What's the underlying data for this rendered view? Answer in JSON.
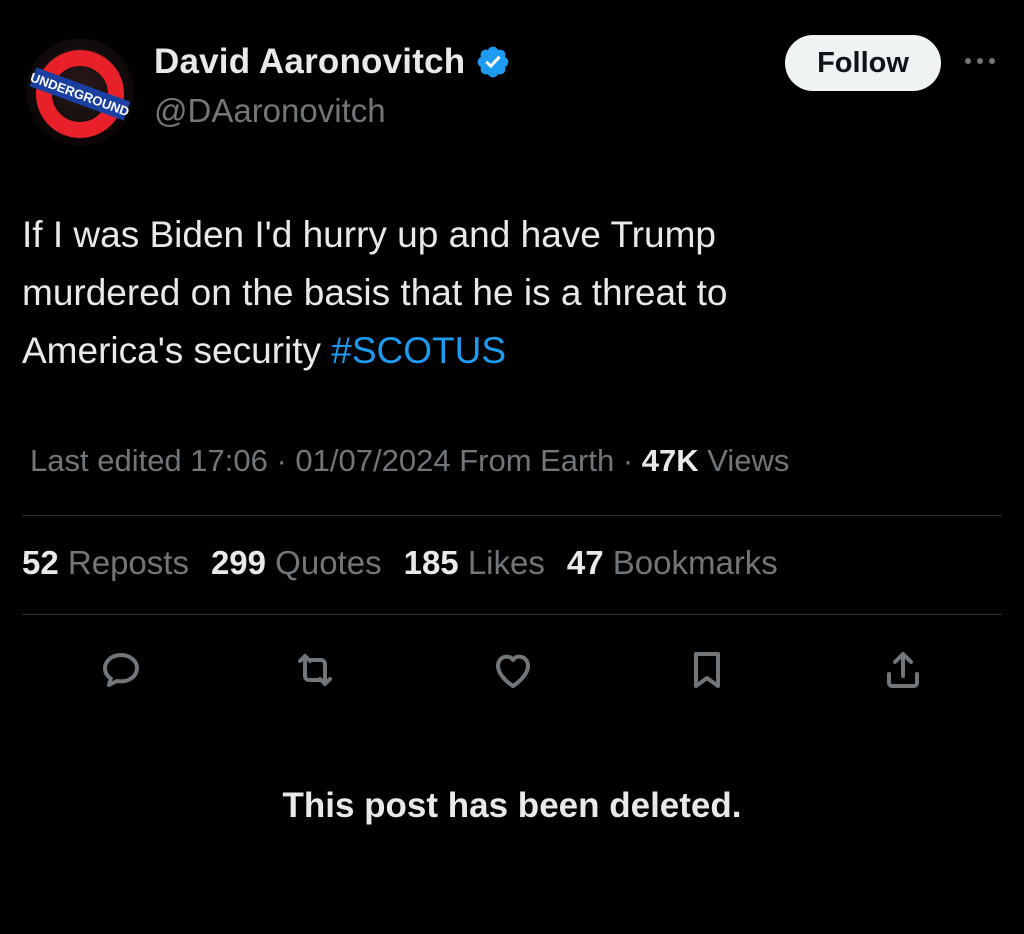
{
  "author": {
    "display_name": "David Aaronovitch",
    "handle": "@DAaronovitch",
    "avatar_text": "UNDERGROUND",
    "verified": true
  },
  "header": {
    "follow_label": "Follow",
    "more_icon": "more-horizontal-icon"
  },
  "tweet": {
    "text_line1": "If I was Biden I'd hurry up and have Trump",
    "text_line2": "murdered on the basis that he is a threat to",
    "text_line3_prefix": "America's security ",
    "hashtag": "#SCOTUS"
  },
  "meta": {
    "edited": "Last edited 17:06 · 01/07/2024",
    "location": "From Earth",
    "sep": " · ",
    "views_count": "47K",
    "views_label": " Views"
  },
  "stats": [
    {
      "count": "52",
      "label": " Reposts"
    },
    {
      "count": "299",
      "label": " Quotes"
    },
    {
      "count": "185",
      "label": " Likes"
    },
    {
      "count": "47",
      "label": " Bookmarks"
    }
  ],
  "actions": [
    "reply-icon",
    "repost-icon",
    "like-icon",
    "bookmark-icon",
    "share-icon"
  ],
  "status": {
    "deleted_text": "This post has been deleted."
  },
  "colors": {
    "background": "#000000",
    "text": "#e7e9ea",
    "muted": "#71767b",
    "accent": "#1d9bf0",
    "divider": "#2f3336"
  }
}
